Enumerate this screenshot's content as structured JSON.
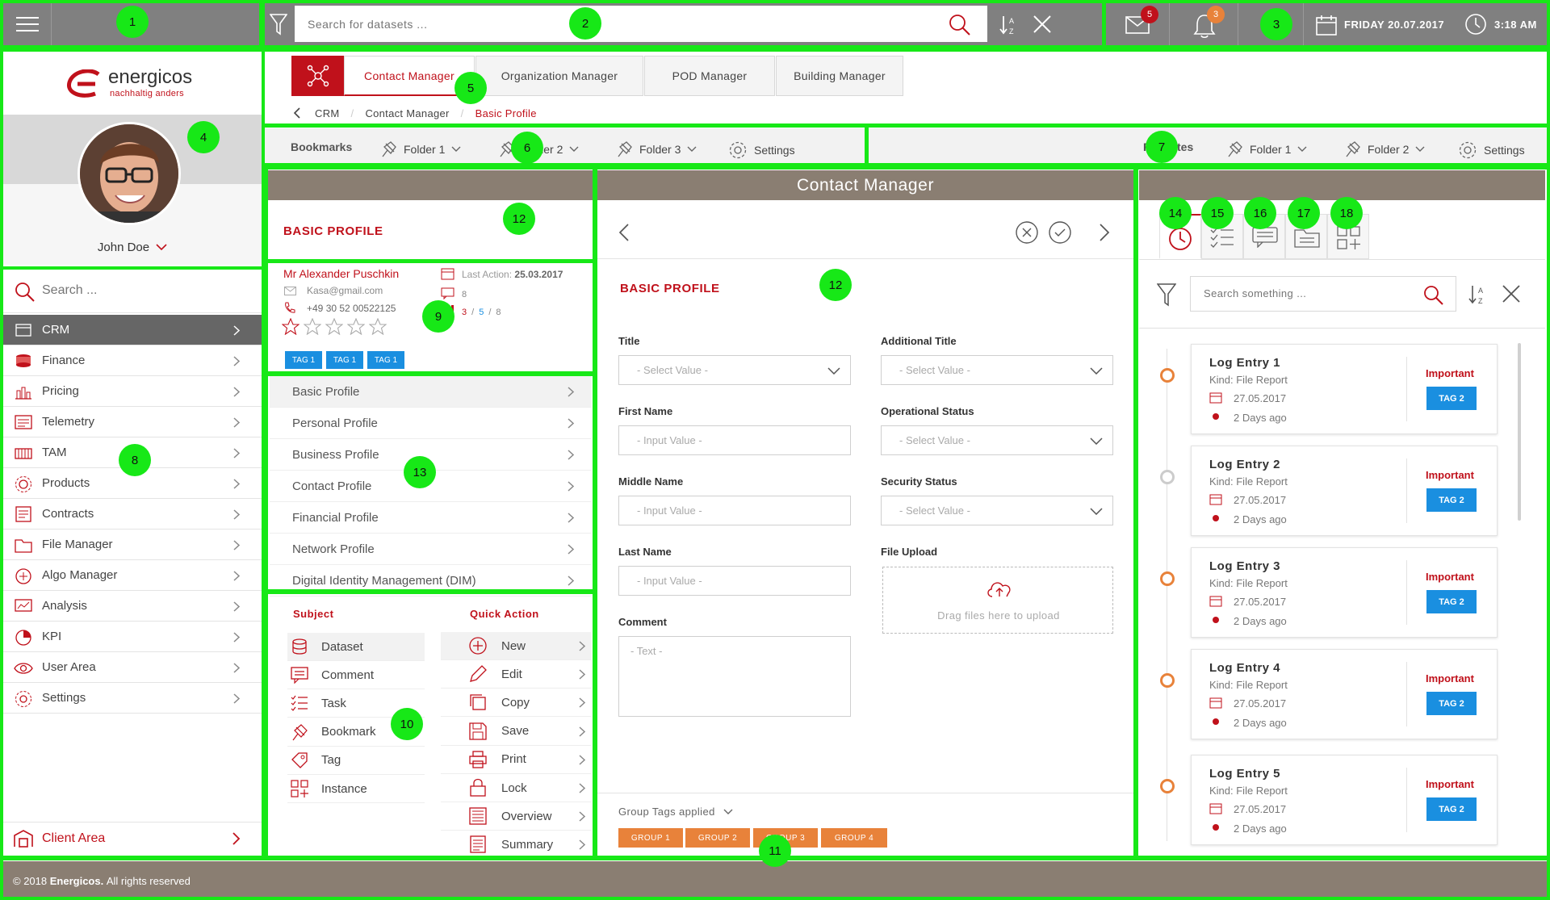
{
  "topbar": {
    "search_placeholder": "Search for datasets ...",
    "mail_count": "5",
    "notification_count": "3",
    "date": "FRIDAY 20.07.2017",
    "time": "3:18 AM"
  },
  "brand": {
    "name": "energicos",
    "tagline": "nachhaltig anders"
  },
  "user": {
    "name": "John Doe"
  },
  "sidebar": {
    "search_placeholder": "Search ...",
    "items": [
      {
        "label": "CRM",
        "icon": "crm-icon"
      },
      {
        "label": "Finance",
        "icon": "coins-icon"
      },
      {
        "label": "Pricing",
        "icon": "pricing-chart-icon"
      },
      {
        "label": "Telemetry",
        "icon": "telemetry-icon"
      },
      {
        "label": "TAM",
        "icon": "tam-icon"
      },
      {
        "label": "Products",
        "icon": "products-icon"
      },
      {
        "label": "Contracts",
        "icon": "contracts-icon"
      },
      {
        "label": "File Manager",
        "icon": "folder-icon"
      },
      {
        "label": "Algo Manager",
        "icon": "algo-icon"
      },
      {
        "label": "Analysis",
        "icon": "analysis-icon"
      },
      {
        "label": "KPI",
        "icon": "kpi-icon"
      },
      {
        "label": "User Area",
        "icon": "eye-icon"
      },
      {
        "label": "Settings",
        "icon": "gear-icon"
      }
    ],
    "client_area": "Client Area"
  },
  "tabs": [
    "Contact Manager",
    "Organization Manager",
    "POD Manager",
    "Building Manager"
  ],
  "breadcrumb": [
    "CRM",
    "Contact Manager",
    "Basic Profile"
  ],
  "bookmarks": {
    "label": "Bookmarks",
    "folders": [
      "Folder 1",
      "Folder 2",
      "Folder 3"
    ],
    "settings": "Settings"
  },
  "favorites": {
    "label": "Favorites",
    "folders": [
      "Folder 1",
      "Folder 2"
    ],
    "settings": "Settings"
  },
  "left_panel": {
    "title": "BASIC PROFILE",
    "contact": {
      "name": "Mr Alexander Puschkin",
      "email": "Kasa@gmail.com",
      "phone": "+49 30 52 00522125",
      "last_action_label": "Last Action:",
      "last_action_date": "25.03.2017",
      "messages": "8",
      "stats_a": "3",
      "stats_b": "5",
      "stats_c": "8",
      "sep": "/",
      "rating": 0,
      "tags": [
        "TAG 1",
        "TAG 1",
        "TAG 1"
      ]
    },
    "profile_menu": [
      "Basic Profile",
      "Personal Profile",
      "Business Profile",
      "Contact Profile",
      "Financial Profile",
      "Network Profile",
      "Digital Identity Management (DIM)"
    ],
    "subject_header": "Subject",
    "quick_action_header": "Quick Action",
    "subjects": [
      "Dataset",
      "Comment",
      "Task",
      "Bookmark",
      "Tag",
      "Instance"
    ],
    "quick_actions": [
      "New",
      "Edit",
      "Copy",
      "Save",
      "Print",
      "Lock",
      "Overview",
      "Summary"
    ]
  },
  "main": {
    "title": "Contact Manager",
    "section_title": "BASIC PROFILE",
    "fields": {
      "title": {
        "label": "Title",
        "placeholder": "- Select Value -"
      },
      "additional_title": {
        "label": "Additional Title",
        "placeholder": "- Select Value -"
      },
      "first_name": {
        "label": "First Name",
        "placeholder": "- Input Value -"
      },
      "operational_status": {
        "label": "Operational Status",
        "placeholder": "- Select Value -"
      },
      "middle_name": {
        "label": "Middle Name",
        "placeholder": "- Input Value -"
      },
      "security_status": {
        "label": "Security Status",
        "placeholder": "- Select Value -"
      },
      "last_name": {
        "label": "Last Name",
        "placeholder": "- Input Value -"
      },
      "file_upload": {
        "label": "File Upload",
        "hint": "Drag files here to upload"
      },
      "comment": {
        "label": "Comment",
        "placeholder": "- Text -"
      }
    },
    "group_tags_label": "Group Tags applied",
    "group_tags": [
      "GROUP 1",
      "GROUP 2",
      "GROUP 3",
      "GROUP 4"
    ]
  },
  "right_panel": {
    "search_placeholder": "Search something ...",
    "logs": [
      {
        "title": "Log Entry 1",
        "kind": "Kind: File Report",
        "date": "27.05.2017",
        "ago": "2 Days ago",
        "priority": "Important",
        "tag": "TAG 2",
        "status_color": "#e8823a"
      },
      {
        "title": "Log Entry 2",
        "kind": "Kind: File Report",
        "date": "27.05.2017",
        "ago": "2 Days ago",
        "priority": "Important",
        "tag": "TAG 2",
        "status_color": "#cccccc"
      },
      {
        "title": "Log Entry 3",
        "kind": "Kind: File Report",
        "date": "27.05.2017",
        "ago": "2 Days ago",
        "priority": "Important",
        "tag": "TAG 2",
        "status_color": "#e8823a"
      },
      {
        "title": "Log Entry 4",
        "kind": "Kind: File Report",
        "date": "27.05.2017",
        "ago": "2 Days ago",
        "priority": "Important",
        "tag": "TAG 2",
        "status_color": "#e8823a"
      },
      {
        "title": "Log Entry 5",
        "kind": "Kind: File Report",
        "date": "27.05.2017",
        "ago": "2 Days ago",
        "priority": "Important",
        "tag": "TAG 2",
        "status_color": "#e8823a"
      }
    ]
  },
  "footer": {
    "prefix": "© 2018",
    "brand": "Energicos.",
    "suffix": "All rights reserved"
  },
  "markers": [
    "1",
    "2",
    "3",
    "4",
    "5",
    "6",
    "7",
    "8",
    "9",
    "10",
    "11",
    "12",
    "12",
    "13",
    "14",
    "15",
    "16",
    "17",
    "18"
  ],
  "colors": {
    "brand_red": "#c0111b",
    "top_bar": "#808080",
    "panel_header": "#8a7e72",
    "highlight_green": "#17e817",
    "tag_blue": "#1a8fe0",
    "group_orange": "#e8823a"
  }
}
